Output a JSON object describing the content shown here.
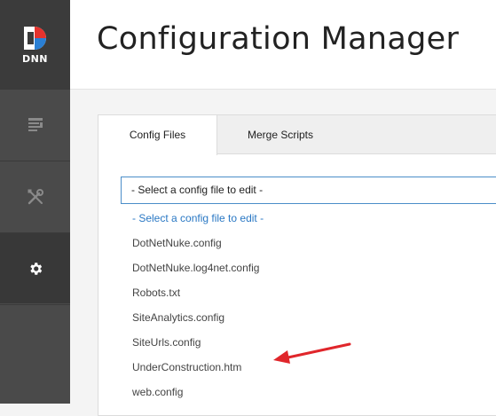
{
  "sidebar": {
    "logo_text": "DNN",
    "items": [
      {
        "icon": "document-list-icon"
      },
      {
        "icon": "tools-icon"
      },
      {
        "icon": "gear-icon"
      }
    ]
  },
  "header": {
    "title": "Configuration Manager"
  },
  "tabs": [
    {
      "label": "Config Files",
      "active": true
    },
    {
      "label": "Merge Scripts",
      "active": false
    }
  ],
  "config_select": {
    "value": "- Select a config file to edit -",
    "options": [
      "- Select a config file to edit -",
      "DotNetNuke.config",
      "DotNetNuke.log4net.config",
      "Robots.txt",
      "SiteAnalytics.config",
      "SiteUrls.config",
      "UnderConstruction.htm",
      "web.config"
    ]
  },
  "colors": {
    "sidebar": "#4a4a4a",
    "logo_red": "#e5322d",
    "logo_blue": "#2a7fd4",
    "accent": "#2a78c4",
    "annotation_arrow": "#e0262b"
  }
}
